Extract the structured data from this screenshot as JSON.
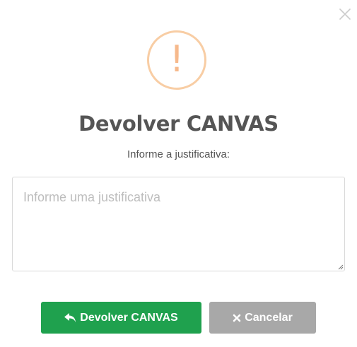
{
  "dialog": {
    "title": "Devolver CANVAS",
    "subtitle": "Informe a justificativa:",
    "icon": "exclamation-icon",
    "icon_color": "#f8bb86",
    "close_icon": "close-icon"
  },
  "justification": {
    "placeholder": "Informe uma justificativa",
    "value": ""
  },
  "buttons": {
    "confirm_label": "Devolver CANVAS",
    "confirm_icon": "reply-icon",
    "confirm_color": "#1fa14e",
    "cancel_label": "Cancelar",
    "cancel_icon": "times-icon",
    "cancel_color": "#a8a8a8"
  }
}
